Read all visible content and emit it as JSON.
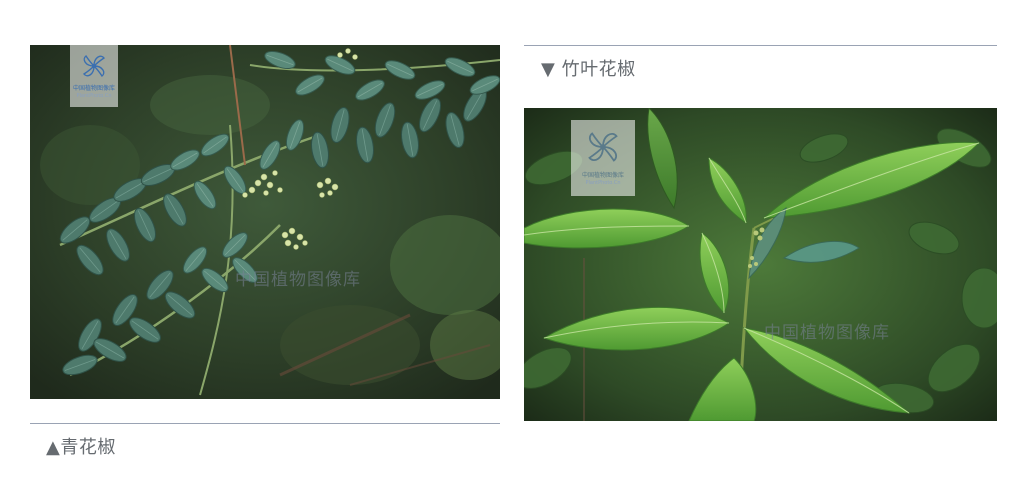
{
  "left_panel": {
    "caption": "▲青花椒",
    "watermark": {
      "title": "中国植物图像库",
      "subtitle": "PlantPhoto.Cn",
      "ghost": "中国植物图像库"
    }
  },
  "right_panel": {
    "caption": "▼   竹叶花椒",
    "watermark": {
      "title": "中国植物图像库",
      "subtitle": "PlantPhoto.Cn",
      "ghost": "中国植物图像库"
    }
  },
  "colors": {
    "rule": "#9aa3b4",
    "caption_text": "#666b70",
    "watermark_blue": "#3b6fb0"
  }
}
